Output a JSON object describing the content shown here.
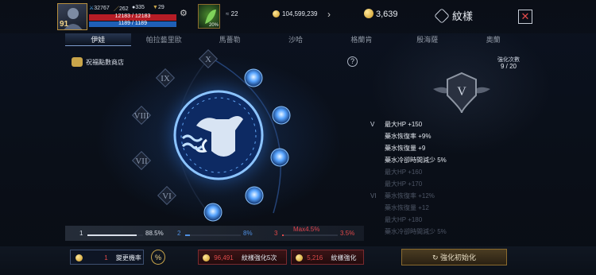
{
  "player": {
    "level": "91",
    "attack": "32767",
    "stat2": "262",
    "stat3": "335",
    "stat4": "29",
    "hp": "12183 / 12183",
    "mp": "1189 / 1189",
    "potion_pct": "20%"
  },
  "resources": {
    "wings": "22",
    "gold": "104,599,239",
    "gems": "3,639"
  },
  "window": {
    "title": "紋樣",
    "close": "✕"
  },
  "tabs": [
    {
      "label": "伊娃",
      "active": true
    },
    {
      "label": "帕拉藝里歐"
    },
    {
      "label": "馬薔勒"
    },
    {
      "label": "沙哈"
    },
    {
      "label": "格蘭肯"
    },
    {
      "label": "殷海薩"
    },
    {
      "label": "奧蘭"
    }
  ],
  "shop_label": "祝福點數商店",
  "help": "?",
  "sign": {
    "roman_numerals": [
      "X",
      "IX",
      "VIII",
      "VII",
      "VI"
    ]
  },
  "enhance": {
    "label": "強化次數",
    "value": "9 / 20"
  },
  "stats": [
    {
      "rank": "V",
      "text": "最大HP +150",
      "dim": false
    },
    {
      "rank": "",
      "text": "藥水恢復率 +9%",
      "dim": false
    },
    {
      "rank": "",
      "text": "藥水恢復量 +9",
      "dim": false
    },
    {
      "rank": "",
      "text": "藥水冷卻時間減少 5%",
      "dim": false
    },
    {
      "rank": "",
      "text": "最大HP +160",
      "dim": true
    },
    {
      "rank": "",
      "text": "最大HP +170",
      "dim": true
    },
    {
      "rank": "VI",
      "text": "藥水恢復率 +12%",
      "dim": true
    },
    {
      "rank": "",
      "text": "藥水恢復量 +12",
      "dim": true
    },
    {
      "rank": "",
      "text": "最大HP +180",
      "dim": true
    },
    {
      "rank": "",
      "text": "藥水冷卻時間減少 5%",
      "dim": true
    }
  ],
  "progress": {
    "segments": [
      {
        "n": "1",
        "pct": "88.5%",
        "fill": 0.885,
        "color": "#d9dfe9"
      },
      {
        "n": "2",
        "pct": "8%",
        "fill": 0.08,
        "color": "#4f8fe0"
      },
      {
        "n": "3",
        "pct": "3.5%",
        "fill": 0.035,
        "color": "#e04a4a"
      }
    ],
    "max_label": "Max4.5%"
  },
  "buttons": {
    "change_count": "1",
    "change_label": "變更機率",
    "pct_icon": "%",
    "x5_cost": "96,491",
    "x5_label": "紋樣強化5次",
    "x1_cost": "5,216",
    "x1_label": "紋樣強化",
    "init_label": "強化初始化"
  },
  "colors": {
    "accent": "#c9a54a",
    "danger": "#e04a4a",
    "glow": "#3f8dff"
  }
}
